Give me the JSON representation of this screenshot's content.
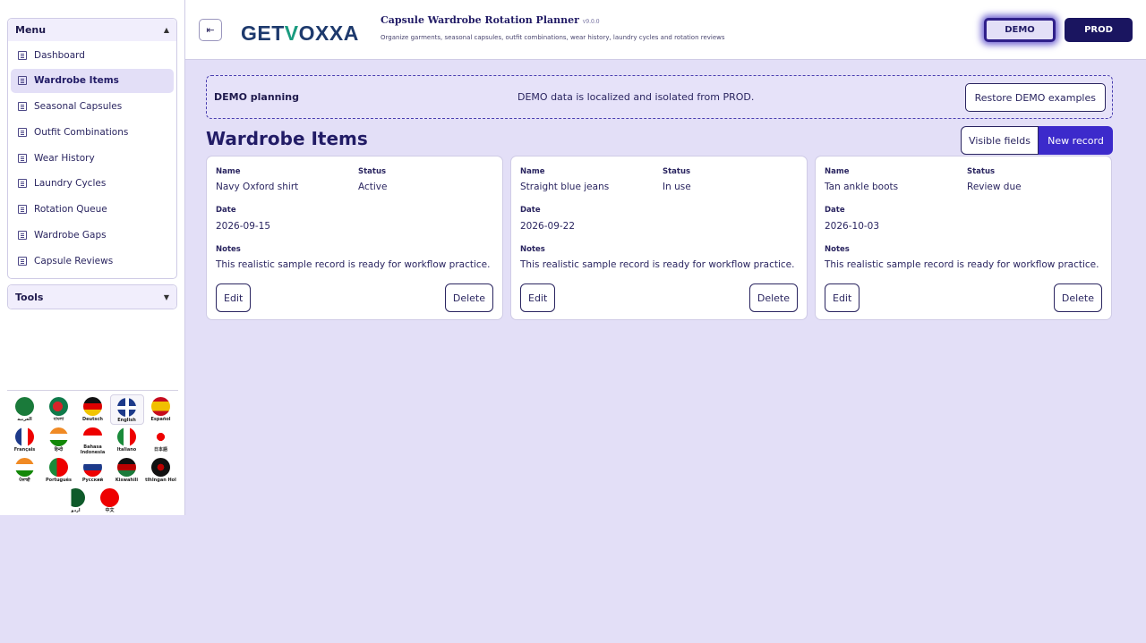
{
  "sidebar": {
    "menu_title": "Menu",
    "tools_title": "Tools",
    "items": [
      {
        "label": "Dashboard"
      },
      {
        "label": "Wardrobe Items"
      },
      {
        "label": "Seasonal Capsules"
      },
      {
        "label": "Outfit Combinations"
      },
      {
        "label": "Wear History"
      },
      {
        "label": "Laundry Cycles"
      },
      {
        "label": "Rotation Queue"
      },
      {
        "label": "Wardrobe Gaps"
      },
      {
        "label": "Capsule Reviews"
      }
    ],
    "active_item": "Wardrobe Items",
    "languages": [
      {
        "label": "العربية",
        "icon": "saudi-flag-icon",
        "color": "#1a7a3a"
      },
      {
        "label": "বাংলা",
        "icon": "bangladesh-flag-icon",
        "color": "#0f7a4a"
      },
      {
        "label": "Deutsch",
        "icon": "germany-flag-icon",
        "color": "#d00"
      },
      {
        "label": "English",
        "icon": "uk-flag-icon",
        "color": "#1d3a8a"
      },
      {
        "label": "Español",
        "icon": "spain-flag-icon",
        "color": "#e8b000"
      },
      {
        "label": "Français",
        "icon": "france-flag-icon",
        "color": "#1d3a8a"
      },
      {
        "label": "हिन्दी",
        "icon": "india-flag-icon",
        "color": "#f08a24"
      },
      {
        "label": "Bahasa Indonesia",
        "icon": "indonesia-flag-icon",
        "color": "#e00"
      },
      {
        "label": "Italiano",
        "icon": "italy-flag-icon",
        "color": "#1a8a3a"
      },
      {
        "label": "日本語",
        "icon": "japan-flag-icon",
        "color": "#e00"
      },
      {
        "label": "ਪੰਜਾਬੀ",
        "icon": "india-punjabi-flag-icon",
        "color": "#f08a24"
      },
      {
        "label": "Português",
        "icon": "portugal-flag-icon",
        "color": "#1a8a3a"
      },
      {
        "label": "Русский",
        "icon": "russia-flag-icon",
        "color": "#1d3a8a"
      },
      {
        "label": "Kiswahili",
        "icon": "kenya-flag-icon",
        "color": "#222"
      },
      {
        "label": "tlhIngan Hol",
        "icon": "klingon-flag-icon",
        "color": "#222"
      },
      {
        "label": "اردو",
        "icon": "pakistan-flag-icon",
        "color": "#0f5a2a"
      },
      {
        "label": "中文",
        "icon": "china-flag-icon",
        "color": "#e00"
      }
    ],
    "selected_language": "English"
  },
  "header": {
    "logo_part1": "GET",
    "logo_part2": "V",
    "logo_part3": "OXXA",
    "app_title": "Capsule Wardrobe Rotation Planner",
    "version": "v9.0.0",
    "subtitle": "Organize garments, seasonal capsules, outfit combinations, wear history, laundry cycles and rotation reviews",
    "env_demo": "DEMO",
    "env_prod": "PROD"
  },
  "banner": {
    "title": "DEMO planning",
    "text": "DEMO data is localized and isolated from PROD.",
    "restore_label": "Restore DEMO examples"
  },
  "main": {
    "page_title": "Wardrobe Items",
    "visible_fields_label": "Visible fields",
    "new_record_label": "New record",
    "field_labels": {
      "name": "Name",
      "status": "Status",
      "date": "Date",
      "notes": "Notes"
    },
    "edit_label": "Edit",
    "delete_label": "Delete",
    "records": [
      {
        "name": "Navy Oxford shirt",
        "status": "Active",
        "date": "2026-09-15",
        "notes": "This realistic sample record is ready for workflow practice."
      },
      {
        "name": "Straight blue jeans",
        "status": "In use",
        "date": "2026-09-22",
        "notes": "This realistic sample record is ready for workflow practice."
      },
      {
        "name": "Tan ankle boots",
        "status": "Review due",
        "date": "2026-10-03",
        "notes": "This realistic sample record is ready for workflow practice."
      }
    ]
  },
  "colors": {
    "accent": "#3c2acb",
    "background": "#e3dff7",
    "dark": "#1a1560"
  }
}
